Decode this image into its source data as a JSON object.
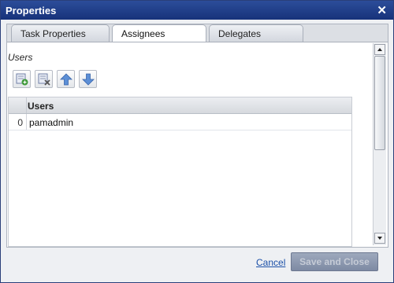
{
  "window": {
    "title": "Properties",
    "close_glyph": "✕"
  },
  "tabs": [
    {
      "label": "Task Properties",
      "active": false
    },
    {
      "label": "Assignees",
      "active": true
    },
    {
      "label": "Delegates",
      "active": false
    }
  ],
  "section": {
    "label": "Users"
  },
  "toolbar": {
    "buttons": [
      {
        "icon": "add-user-icon"
      },
      {
        "icon": "remove-user-icon"
      },
      {
        "icon": "move-up-icon"
      },
      {
        "icon": "move-down-icon"
      }
    ]
  },
  "grid": {
    "column_header": "Users",
    "rows": [
      {
        "index": "0",
        "value": "pamadmin"
      }
    ]
  },
  "footer": {
    "cancel_label": "Cancel",
    "save_label": "Save and Close"
  },
  "colors": {
    "titlebar": "#1f3d8a",
    "link": "#1a4fa8",
    "save_disabled": "#8e99b0"
  }
}
